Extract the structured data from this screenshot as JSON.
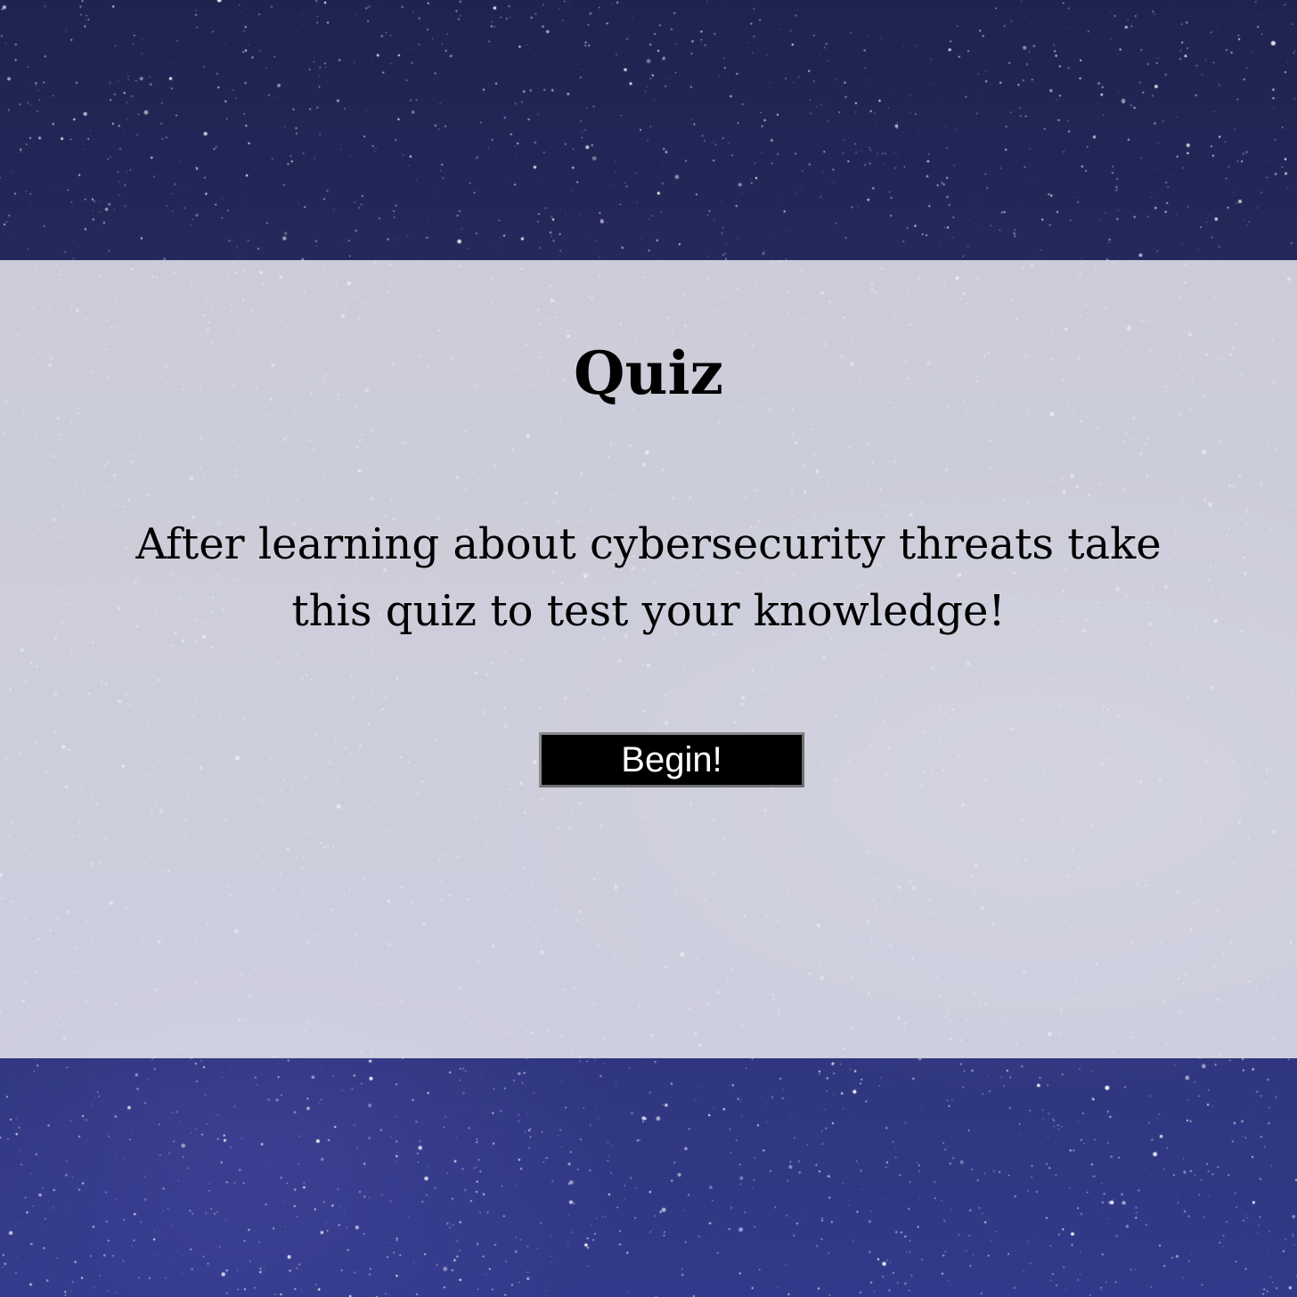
{
  "quiz": {
    "title": "Quiz",
    "intro_line1": "After learning about cybersecurity threats take",
    "intro_line2": "this quiz to test your knowledge!",
    "begin_label": "Begin!"
  },
  "theme": {
    "panel_color": "#e8e8ee",
    "button_bg": "#000000",
    "button_text": "#ffffff",
    "background": "starry night sky"
  }
}
